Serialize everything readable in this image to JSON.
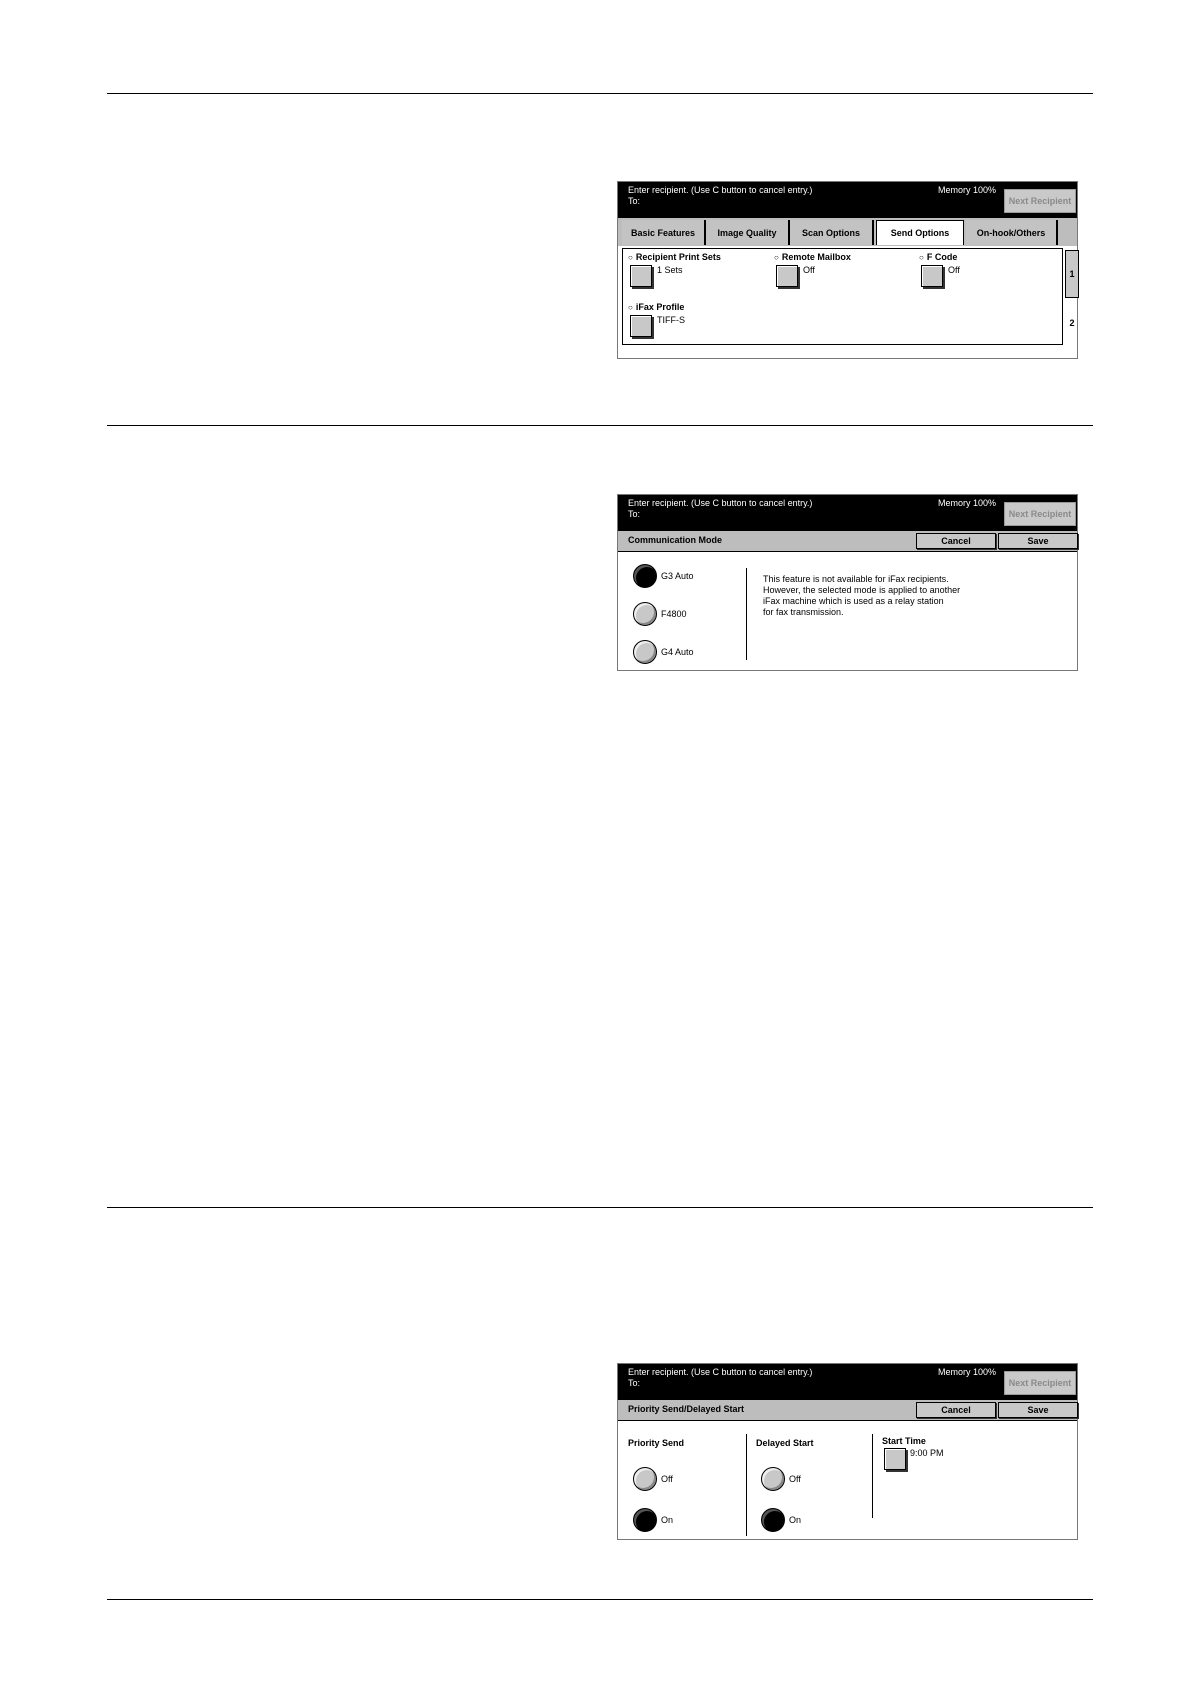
{
  "panel1": {
    "message_line1": "Enter recipient.  (Use C button to cancel entry.)",
    "message_line2": "To:",
    "memory": "Memory 100%",
    "next_recipient": "Next Recipient",
    "tabs": [
      "Basic Features",
      "Image Quality",
      "Scan Options",
      "Send Options",
      "On-hook/Others"
    ],
    "active_tab": "Send Options",
    "features": [
      {
        "label": "Recipient Print Sets",
        "value": "1 Sets"
      },
      {
        "label": "Remote Mailbox",
        "value": "Off"
      },
      {
        "label": "F Code",
        "value": "Off"
      },
      {
        "label": "iFax Profile",
        "value": "TIFF-S"
      }
    ],
    "pages": [
      "1",
      "2"
    ]
  },
  "panel2": {
    "message_line1": "Enter recipient.  (Use C button to cancel entry.)",
    "message_line2": "To:",
    "memory": "Memory 100%",
    "next_recipient": "Next Recipient",
    "title": "Communication Mode",
    "cancel": "Cancel",
    "save": "Save",
    "options": [
      {
        "label": "G3 Auto",
        "selected": true
      },
      {
        "label": "F4800",
        "selected": false
      },
      {
        "label": "G4 Auto",
        "selected": false
      }
    ],
    "note_lines": [
      "This feature is not available for iFax recipients.",
      "However, the selected mode is applied to another",
      "iFax machine which is used as a relay station",
      "for fax transmission."
    ]
  },
  "panel3": {
    "message_line1": "Enter recipient.  (Use C button to cancel entry.)",
    "message_line2": "To:",
    "memory": "Memory 100%",
    "next_recipient": "Next Recipient",
    "title": "Priority Send/Delayed Start",
    "cancel": "Cancel",
    "save": "Save",
    "priority_send": {
      "heading": "Priority Send",
      "off": "Off",
      "on": "On",
      "selected": "On"
    },
    "delayed_start": {
      "heading": "Delayed Start",
      "off": "Off",
      "on": "On",
      "selected": "On"
    },
    "start_time": {
      "heading": "Start Time",
      "value": "9:00 PM"
    }
  }
}
